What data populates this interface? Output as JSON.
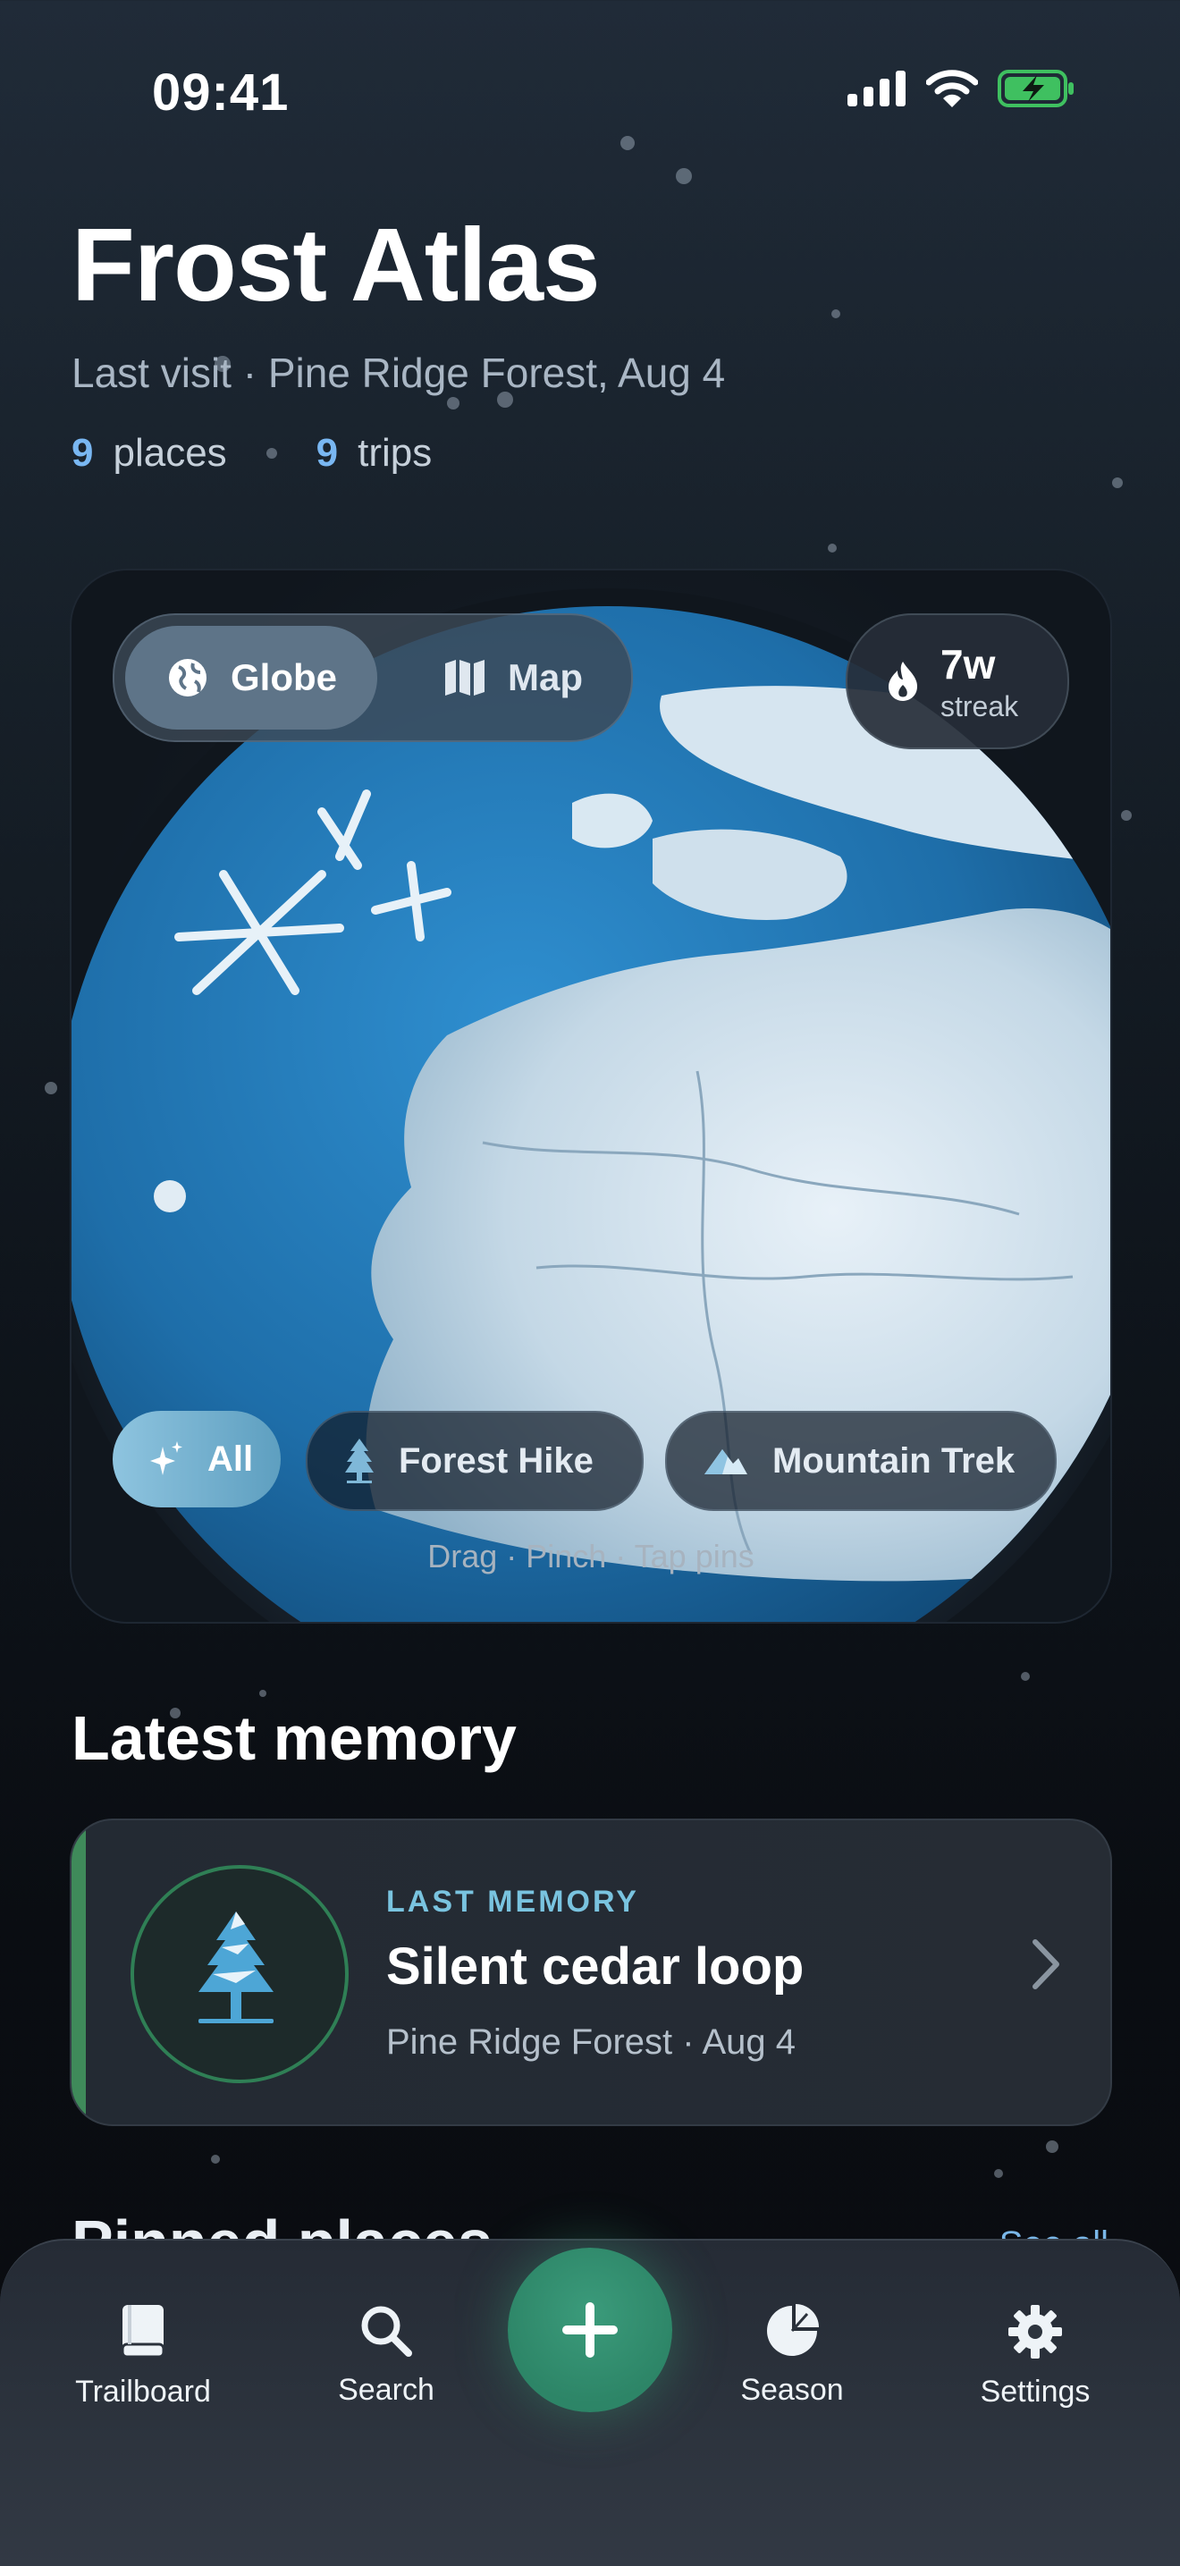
{
  "status_bar": {
    "time": "09:41",
    "icons": [
      "cellular-signal-icon",
      "wifi-icon",
      "battery-charging-icon"
    ]
  },
  "header": {
    "title": "Frost Atlas",
    "subtitle": "Last visit · Pine Ridge Forest, Aug 4",
    "stats": [
      {
        "value": "9",
        "label": "places"
      },
      {
        "value": "9",
        "label": "trips"
      }
    ]
  },
  "globe_card": {
    "view_toggle": [
      {
        "label": "Globe",
        "icon": "globe-icon",
        "selected": true
      },
      {
        "label": "Map",
        "icon": "map-icon",
        "selected": false
      }
    ],
    "streak": {
      "value": "7w",
      "label": "streak",
      "icon": "flame-icon"
    },
    "filters": [
      {
        "label": "All",
        "icon": "sparkle-icon",
        "selected": true
      },
      {
        "label": "Forest Hike",
        "icon": "pine-tree-icon",
        "selected": false
      },
      {
        "label": "Mountain Trek",
        "icon": "mountain-icon",
        "selected": false
      }
    ],
    "hint": "Drag · Pinch · Tap pins"
  },
  "latest_memory": {
    "section_title": "Latest memory",
    "kicker": "LAST MEMORY",
    "title": "Silent cedar loop",
    "subtitle": "Pine Ridge Forest · Aug 4",
    "thumb_icon": "snowy-pine-tree-icon",
    "accent": "#3f8a5a"
  },
  "pinned_places": {
    "section_title": "Pinned places",
    "see_all": "See all"
  },
  "tab_bar": {
    "tabs": [
      {
        "label": "Trailboard",
        "icon": "book-icon"
      },
      {
        "label": "Search",
        "icon": "search-icon"
      },
      {
        "label": "Season",
        "icon": "pie-chart-icon"
      },
      {
        "label": "Settings",
        "icon": "gear-icon"
      }
    ],
    "fab": {
      "icon": "plus-icon",
      "color": "#2d8567"
    }
  },
  "colors": {
    "accent_blue": "#79b7f2",
    "accent_teal": "#79c3df",
    "accent_green": "#2d8567"
  }
}
